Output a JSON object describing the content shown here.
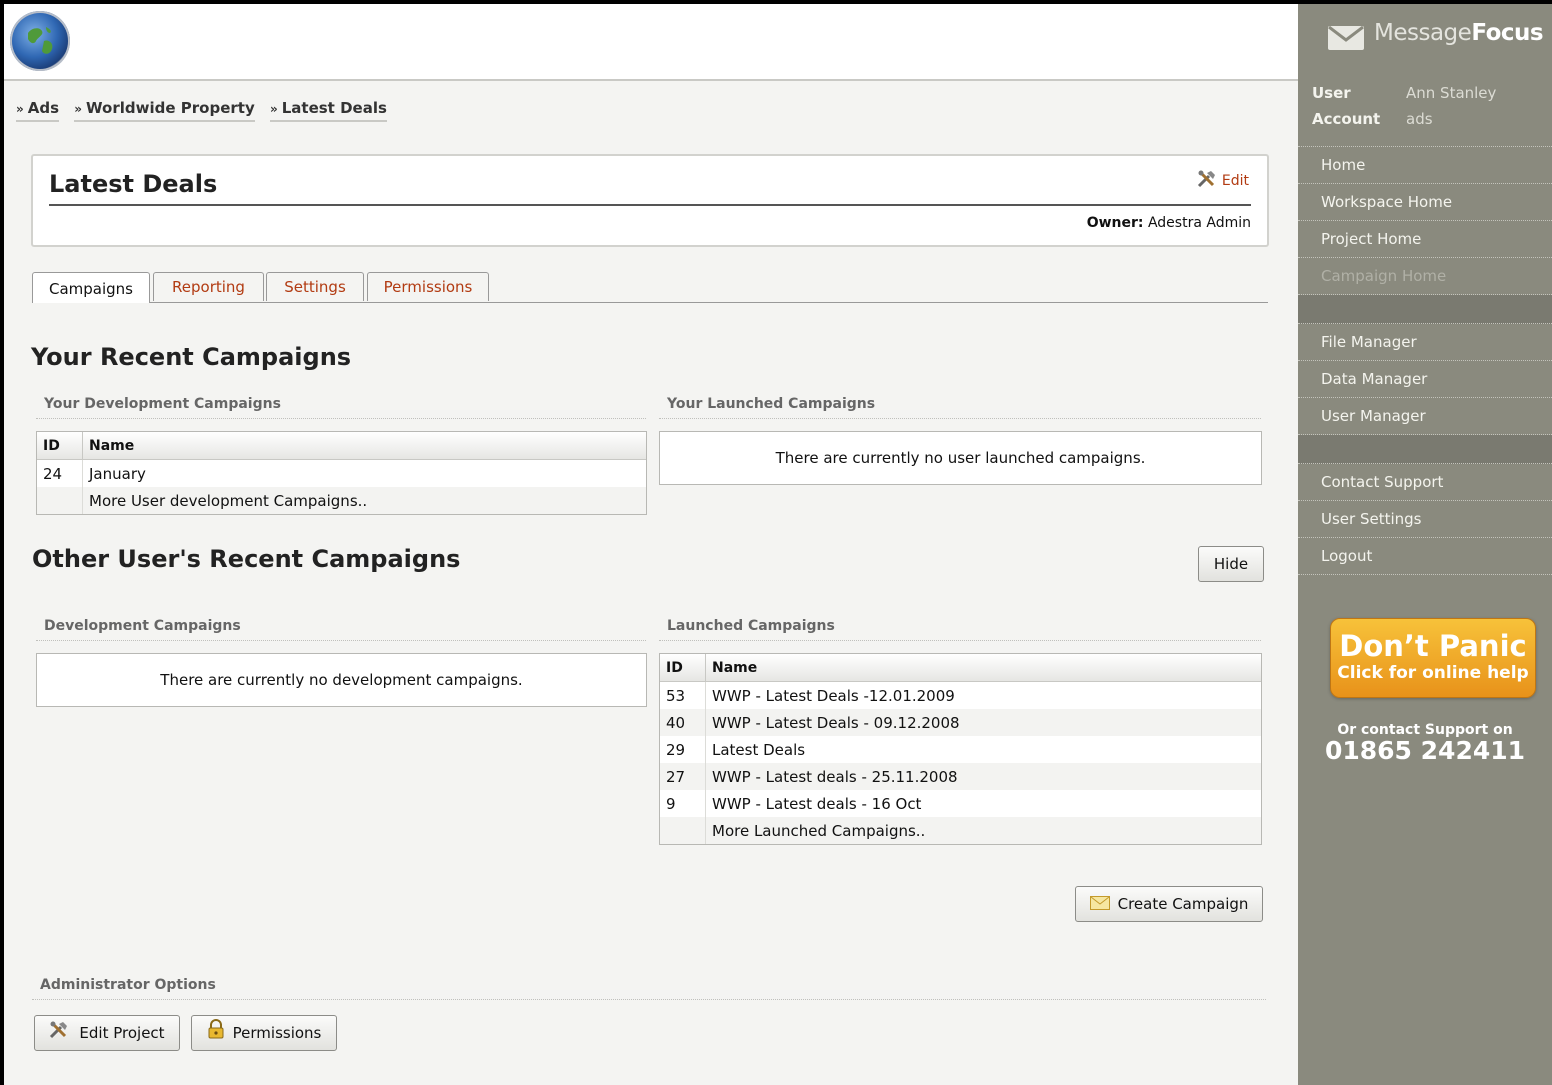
{
  "breadcrumb": [
    "Ads",
    "Worldwide Property",
    "Latest Deals"
  ],
  "header": {
    "title": "Latest Deals",
    "edit_label": "Edit",
    "owner_label": "Owner:",
    "owner_value": "Adestra Admin"
  },
  "tabs": [
    "Campaigns",
    "Reporting",
    "Settings",
    "Permissions"
  ],
  "recent": {
    "heading": "Your Recent Campaigns",
    "dev_label": "Your Development Campaigns",
    "launched_label": "Your Launched Campaigns",
    "launched_empty": "There are currently no user launched campaigns.",
    "columns": [
      "ID",
      "Name"
    ],
    "dev_rows": [
      {
        "id": "24",
        "name": "January"
      },
      {
        "id": "",
        "name": "More User development Campaigns.."
      }
    ]
  },
  "other": {
    "heading": "Other User's Recent Campaigns",
    "hide_label": "Hide",
    "dev_label": "Development Campaigns",
    "dev_empty": "There are currently no development campaigns.",
    "launched_label": "Launched Campaigns",
    "columns": [
      "ID",
      "Name"
    ],
    "launched_rows": [
      {
        "id": "53",
        "name": "WWP - Latest Deals -12.01.2009"
      },
      {
        "id": "40",
        "name": "WWP - Latest Deals - 09.12.2008"
      },
      {
        "id": "29",
        "name": "Latest Deals"
      },
      {
        "id": "27",
        "name": "WWP - Latest deals - 25.11.2008"
      },
      {
        "id": "9",
        "name": "WWP - Latest deals - 16 Oct"
      },
      {
        "id": "",
        "name": "More Launched Campaigns.."
      }
    ]
  },
  "create_campaign_label": "Create Campaign",
  "admin": {
    "label": "Administrator Options",
    "edit_project_label": "Edit Project",
    "permissions_label": "Permissions"
  },
  "sidebar": {
    "brand_light": "Message",
    "brand_bold": "Focus",
    "user_key": "User",
    "user_value": "Ann Stanley",
    "account_key": "Account",
    "account_value": "ads",
    "nav_group1": [
      "Home",
      "Workspace Home",
      "Project Home",
      "Campaign Home"
    ],
    "nav_group2": [
      "File Manager",
      "Data Manager",
      "User Manager"
    ],
    "nav_group3": [
      "Contact Support",
      "User Settings",
      "Logout"
    ],
    "panic_title": "Don’t Panic",
    "panic_sub": "Click for online help",
    "support_line": "Or contact Support on",
    "support_phone": "01865 242411"
  },
  "colors": {
    "accent_link": "#b23b12",
    "sidebar_bg": "#8a8a7e",
    "panic_orange": "#f0a82a"
  }
}
